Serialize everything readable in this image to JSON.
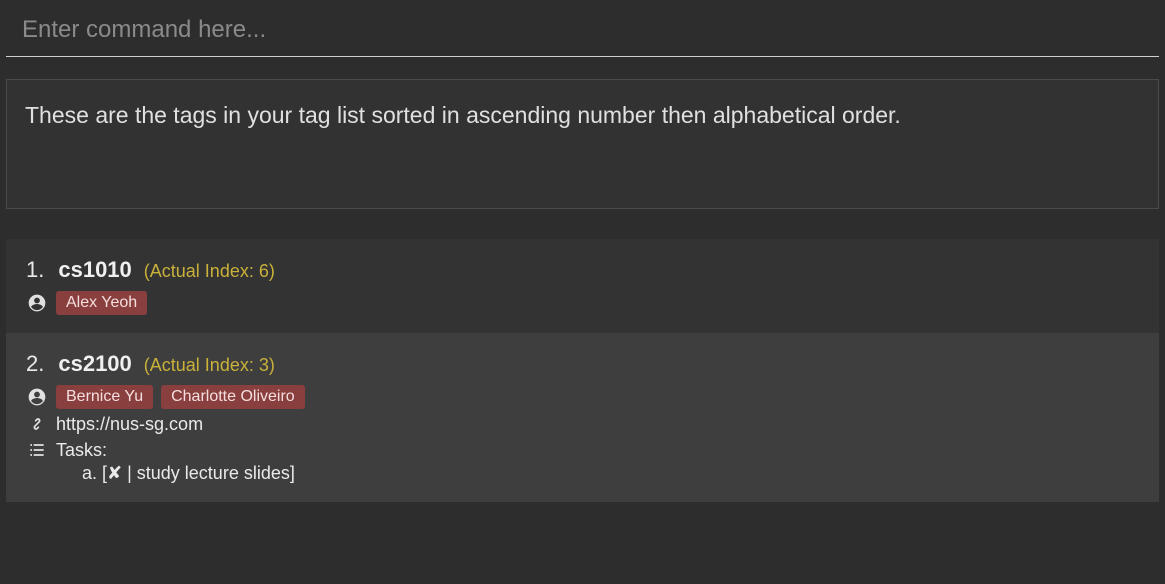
{
  "command_placeholder": "Enter command here...",
  "message": "These are the tags in your tag list sorted in ascending number then alphabetical order.",
  "tags": [
    {
      "display_index": "1.",
      "name": "cs1010",
      "actual_index_label": "(Actual Index: 6)",
      "persons": [
        "Alex Yeoh"
      ],
      "link": "",
      "tasks_label": "",
      "tasks": []
    },
    {
      "display_index": "2.",
      "name": "cs2100",
      "actual_index_label": "(Actual Index: 3)",
      "persons": [
        "Bernice Yu",
        "Charlotte Oliveiro"
      ],
      "link": "https://nus-sg.com",
      "tasks_label": "Tasks:",
      "tasks": [
        "a. [✘ | study lecture slides]"
      ]
    }
  ]
}
